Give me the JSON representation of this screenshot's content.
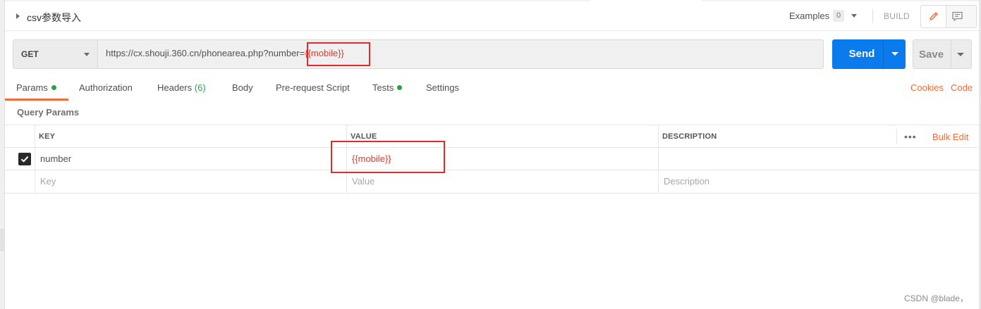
{
  "request": {
    "title": "csv参数导入",
    "examples_label": "Examples",
    "examples_count": "0",
    "build_label": "BUILD",
    "edit_icon": "pencil-icon",
    "comment_icon": "comment-icon"
  },
  "url_bar": {
    "method": "GET",
    "url_prefix": "https://cx.shouji.360.cn/phonearea.php?number=",
    "url_variable": "{{mobile}}"
  },
  "actions": {
    "send_label": "Send",
    "save_label": "Save"
  },
  "tabs": [
    {
      "label": "Params",
      "has_dot": true,
      "active": true
    },
    {
      "label": "Authorization"
    },
    {
      "label": "Headers",
      "count": "(6)"
    },
    {
      "label": "Body"
    },
    {
      "label": "Pre-request Script"
    },
    {
      "label": "Tests",
      "has_dot": true
    },
    {
      "label": "Settings"
    }
  ],
  "right_links": {
    "cookies": "Cookies",
    "code": "Code"
  },
  "params": {
    "section_title": "Query Params",
    "columns": [
      "KEY",
      "VALUE",
      "DESCRIPTION"
    ],
    "more_label": "•••",
    "bulk_edit": "Bulk Edit",
    "rows": [
      {
        "checked": true,
        "key": "number",
        "value": "{{mobile}}",
        "description": ""
      }
    ],
    "placeholder": {
      "key": "Key",
      "value": "Value",
      "description": "Description"
    }
  },
  "colors": {
    "accent": "#f26b3a",
    "send_blue": "#097bed",
    "variable_red": "#e4372a",
    "status_green": "#27a048",
    "highlight_box": "#e12b2b"
  },
  "watermark": "CSDN @blade，"
}
